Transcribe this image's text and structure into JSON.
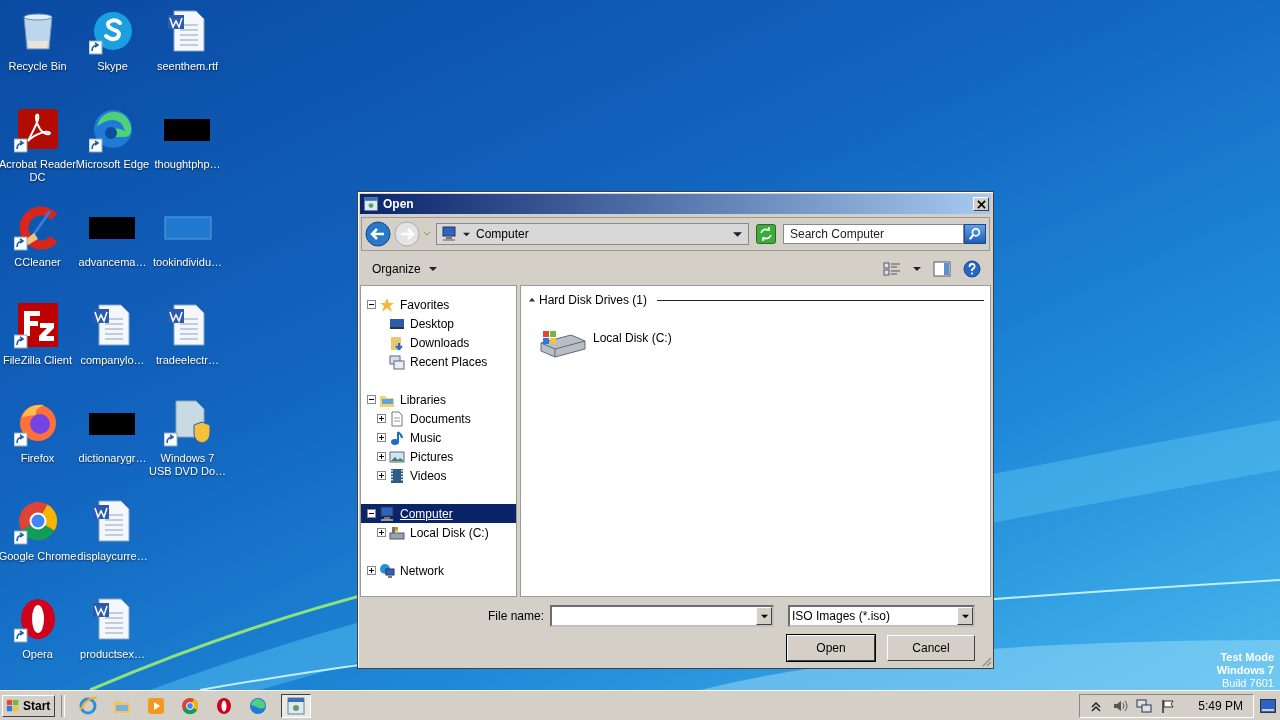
{
  "desktop_icons": [
    {
      "label": "Recycle Bin",
      "kind": "recycle",
      "shortcut": false
    },
    {
      "label": "Acrobat Reader DC",
      "kind": "acrobat",
      "shortcut": true
    },
    {
      "label": "CCleaner",
      "kind": "ccleaner",
      "shortcut": true
    },
    {
      "label": "FileZilla Client",
      "kind": "filezilla",
      "shortcut": true
    },
    {
      "label": "Firefox",
      "kind": "firefox",
      "shortcut": true
    },
    {
      "label": "Google Chrome",
      "kind": "chrome",
      "shortcut": true
    },
    {
      "label": "Opera",
      "kind": "opera",
      "shortcut": true
    },
    {
      "label": "Skype",
      "kind": "skype",
      "shortcut": true
    },
    {
      "label": "Microsoft Edge",
      "kind": "edge",
      "shortcut": true
    },
    {
      "label": "advancema…",
      "kind": "redacted",
      "shortcut": false
    },
    {
      "label": "companylo…",
      "kind": "word",
      "shortcut": false
    },
    {
      "label": "dictionarygr…",
      "kind": "redacted",
      "shortcut": false
    },
    {
      "label": "displaycurre…",
      "kind": "word",
      "shortcut": false
    },
    {
      "label": "productsex…",
      "kind": "word",
      "shortcut": false
    },
    {
      "label": "seenthem.rtf",
      "kind": "word",
      "shortcut": false
    },
    {
      "label": "thoughtphp…",
      "kind": "redacted",
      "shortcut": false
    },
    {
      "label": "tookindividu…",
      "kind": "blank",
      "shortcut": false
    },
    {
      "label": "tradeelectr…",
      "kind": "word",
      "shortcut": false
    },
    {
      "label": "Windows 7 USB DVD Do…",
      "kind": "installer",
      "shortcut": true
    }
  ],
  "dialog": {
    "title": "Open",
    "location": "Computer",
    "search": {
      "placeholder": "Search Computer"
    },
    "organize": "Organize",
    "nav_tree": [
      {
        "label": "Favorites",
        "kind": "star",
        "expanded": true,
        "selected": false,
        "children": [
          {
            "label": "Desktop",
            "kind": "desktop",
            "selected": false
          },
          {
            "label": "Downloads",
            "kind": "downloads",
            "selected": false
          },
          {
            "label": "Recent Places",
            "kind": "recent",
            "selected": false
          }
        ]
      },
      {
        "label": "Libraries",
        "kind": "libraries",
        "expanded": true,
        "selected": false,
        "children": [
          {
            "label": "Documents",
            "kind": "documents",
            "expanded": false,
            "selected": false
          },
          {
            "label": "Music",
            "kind": "music",
            "expanded": false,
            "selected": false
          },
          {
            "label": "Pictures",
            "kind": "pictures",
            "expanded": false,
            "selected": false
          },
          {
            "label": "Videos",
            "kind": "videos",
            "expanded": false,
            "selected": false
          }
        ]
      },
      {
        "label": "Computer",
        "kind": "computer",
        "expanded": true,
        "selected": true,
        "children": [
          {
            "label": "Local Disk (C:)",
            "kind": "drive",
            "expanded": false,
            "selected": false
          }
        ]
      },
      {
        "label": "Network",
        "kind": "network",
        "expanded": false,
        "selected": false
      }
    ],
    "groups": [
      {
        "header": "Hard Disk Drives (1)",
        "expanded": true,
        "items": [
          {
            "label": "Local Disk (C:)",
            "kind": "drive"
          }
        ]
      }
    ],
    "file_name": {
      "label": "File name:"
    },
    "file_type": {
      "value": "ISO Images (*.iso)"
    },
    "buttons": [
      {
        "label": "Open",
        "default": true
      },
      {
        "label": "Cancel",
        "default": false
      }
    ]
  },
  "system_notice": [
    {
      "text": "Test Mode",
      "bold": true
    },
    {
      "text": "Windows 7",
      "bold": true
    },
    {
      "text": "Build 7601",
      "bold": false
    }
  ],
  "taskbar": {
    "start": "Start",
    "pinned": [
      {
        "kind": "ie"
      },
      {
        "kind": "explorer"
      },
      {
        "kind": "media"
      },
      {
        "kind": "chrome"
      },
      {
        "kind": "opera"
      },
      {
        "kind": "edge"
      }
    ],
    "tasks": [
      {
        "kind": "dialog",
        "active": true
      }
    ],
    "tray": [
      {
        "kind": "up"
      },
      {
        "kind": "speaker"
      },
      {
        "kind": "network"
      },
      {
        "kind": "flag"
      }
    ],
    "clock": "5:49 PM"
  }
}
